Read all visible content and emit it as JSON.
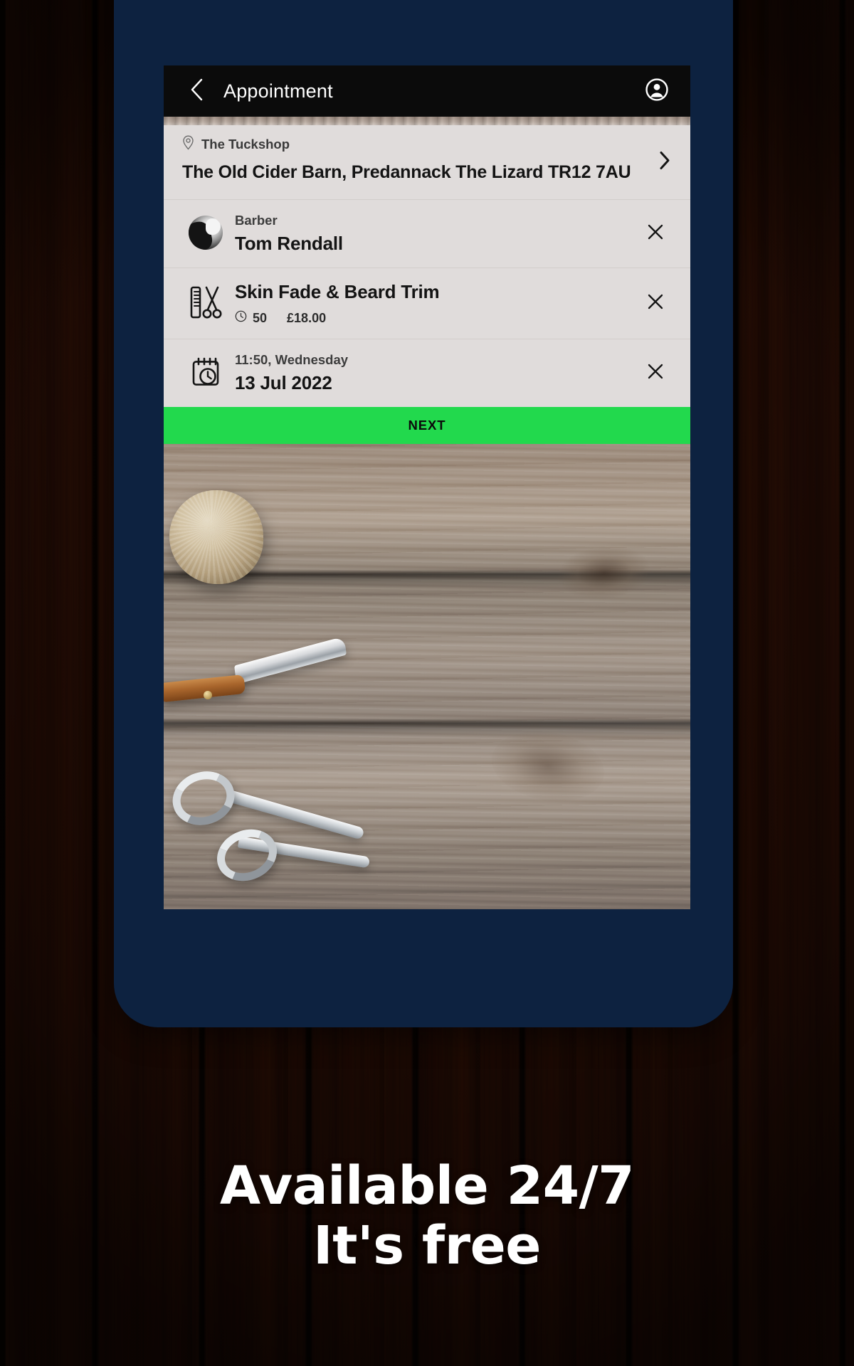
{
  "app": {
    "appbar": {
      "back_icon": "chevron-left-icon",
      "title": "Appointment",
      "account_icon": "account-circle-icon"
    },
    "summary": {
      "address_row": {
        "pin_icon": "location-pin-icon",
        "shop_name": "The Tuckshop",
        "address": "The Old Cider Barn, Predannack The Lizard TR12 7AU",
        "chevron_icon": "chevron-right-icon"
      },
      "barber_row": {
        "avatar": "barber-avatar",
        "label": "Barber",
        "value": "Tom Rendall",
        "remove_icon": "close-x-icon"
      },
      "service_row": {
        "icon": "comb-and-scissors-icon",
        "title": "Skin Fade & Beard Trim",
        "duration_icon": "clock-icon",
        "duration": "50",
        "price": "£18.00",
        "remove_icon": "close-x-icon"
      },
      "datetime_row": {
        "icon": "calendar-clock-icon",
        "time_and_day": "11:50,  Wednesday",
        "date": "13 Jul 2022",
        "remove_icon": "close-x-icon"
      }
    },
    "next_button": {
      "label": "NEXT",
      "color": "#22d94d",
      "text_color": "#0b0b0b"
    },
    "hero_photo": "barber-tools-on-wood-photo"
  },
  "promo": {
    "line1": "Available 24/7",
    "line2": "It's free"
  },
  "theme": {
    "frame_navy": "#0d2240",
    "appbar_black": "#0b0b0b",
    "card_background": "#e0dcdb",
    "accent_green": "#22d94d",
    "promo_text": "#ffffff"
  }
}
